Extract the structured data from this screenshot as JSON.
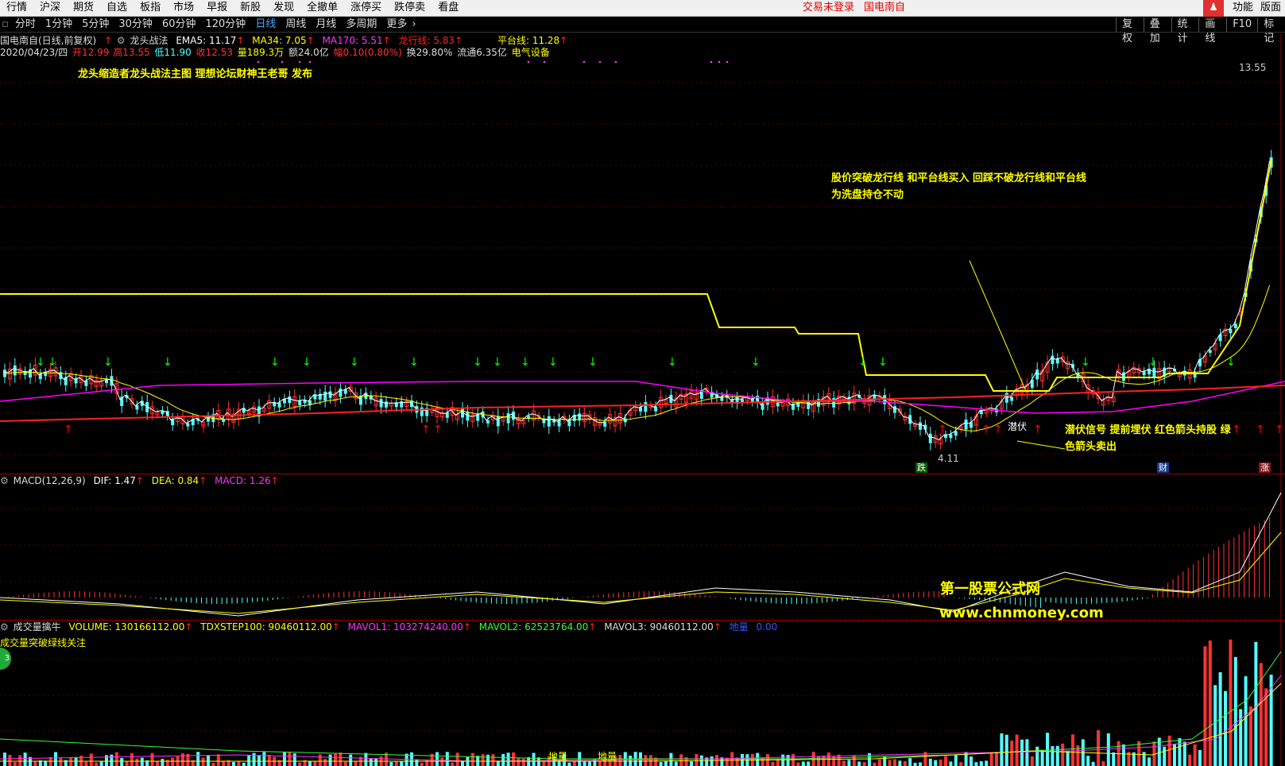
{
  "menu": {
    "items": [
      "行情",
      "沪深",
      "期货",
      "自选",
      "板指",
      "市场",
      "早报",
      "新股",
      "发现",
      "全撤单",
      "涨停买",
      "跌停卖",
      "看盘"
    ],
    "status": "交易未登录",
    "stock_name": "国电南自",
    "func": "功能",
    "layout": "版面",
    "user_icon": "user-icon"
  },
  "period": {
    "items": [
      "分时",
      "1分钟",
      "5分钟",
      "30分钟",
      "60分钟",
      "120分钟",
      "日线",
      "周线",
      "月线",
      "多周期",
      "更多"
    ],
    "active": "日线",
    "tools": [
      "复权",
      "叠加",
      "统计",
      "画线",
      "F10",
      "标记"
    ]
  },
  "main_legend": {
    "name": "国电南自(日线,前复权)",
    "indicator": "龙头战法",
    "ema5": "EMA5: 11.17",
    "ma34": "MA34: 7.05",
    "ma170": "MA170: 5.51",
    "longxing": "龙行线: 5.83",
    "pingtai": "平台线: 11.28"
  },
  "info_line": {
    "date": "2020/04/23/四",
    "open": "开12.99",
    "high": "高13.55",
    "low": "低11.90",
    "close": "收12.53",
    "vol": "量189.3万",
    "amount": "额24.0亿",
    "change": "幅0.10(0.80%)",
    "turnover": "换29.80%",
    "float": "流通6.35亿",
    "sector": "电气设备"
  },
  "notes": {
    "publisher": "龙头缩造者龙头战法主图 理想论坛财神王老哥 发布",
    "buy_line1": "股价突破龙行线 和平台线买入 回踩不破龙行线和平台线",
    "buy_line2": "为洗盘持仓不动",
    "signal_line1": "潜伏信号 提前埋伏 红色箭头持股 绿",
    "signal_line2": "色箭头卖出"
  },
  "annotations": {
    "high_price": "13.55",
    "low_price": "4.11",
    "qianfu": "潜伏",
    "die": "跌",
    "cai": "财",
    "zhang": "涨"
  },
  "macd_legend": {
    "name": "MACD(12,26,9)",
    "dif": "DIF: 1.47",
    "dea": "DEA: 0.84",
    "macd": "MACD: 1.26"
  },
  "vol_legend": {
    "name": "成交量擒牛",
    "volume": "VOLUME: 130166112.00",
    "tdx": "TDXSTEP100: 90460112.00",
    "mavol1": "MAVOL1: 103274240.00",
    "mavol2": "MAVOL2: 62523764.00",
    "mavol3": "MAVOL3: 90460112.00",
    "diliang": "地量",
    "diliang_val": "0.00",
    "note": "成交量突破绿线关注",
    "badge": "3",
    "diliang_mark1": "地量",
    "diliang_mark2": "地量"
  },
  "watermark": {
    "site": "第一股票公式网",
    "url": "www.chnmoney.com"
  },
  "colors": {
    "bg": "#000000",
    "up": "#ff3232",
    "down": "#54ffff",
    "ema5": "#ffffff",
    "ma34": "#ffff00",
    "ma170": "#ff00ff",
    "longxing": "#ff2020",
    "pingtai": "#ffff00",
    "buy_arrow": "#ff0000",
    "sell_arrow": "#00ff00"
  },
  "chart_data": {
    "type": "candlestick",
    "period": "日线",
    "price_high": 13.55,
    "price_low": 4.11,
    "last_close": 12.53
  }
}
